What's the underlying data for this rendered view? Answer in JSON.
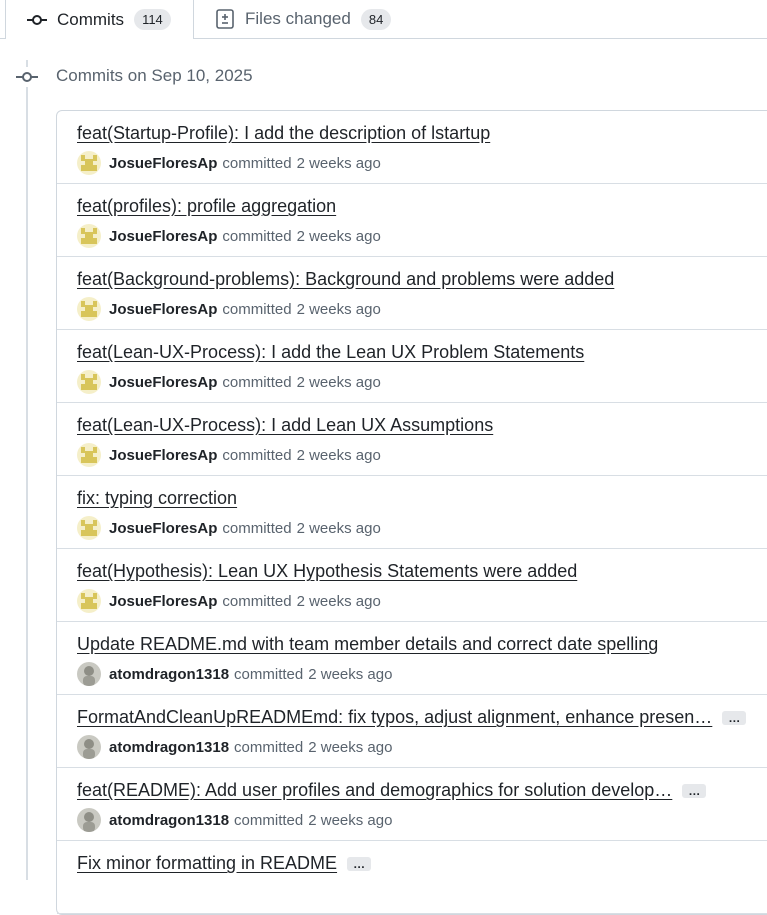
{
  "tabs": {
    "commits": {
      "label": "Commits",
      "count": "114"
    },
    "files": {
      "label": "Files changed",
      "count": "84"
    }
  },
  "group": {
    "heading": "Commits on Sep 10, 2025"
  },
  "commits": [
    {
      "title": "feat(Startup-Profile): I add the description of lstartup",
      "author": "JosueFloresAp",
      "action": "committed",
      "time": "2 weeks ago",
      "has_more": false,
      "avatar": "yellow-identicon"
    },
    {
      "title": "feat(profiles): profile aggregation",
      "author": "JosueFloresAp",
      "action": "committed",
      "time": "2 weeks ago",
      "has_more": false,
      "avatar": "yellow-identicon"
    },
    {
      "title": "feat(Background-problems): Background and problems were added",
      "author": "JosueFloresAp",
      "action": "committed",
      "time": "2 weeks ago",
      "has_more": false,
      "avatar": "yellow-identicon"
    },
    {
      "title": "feat(Lean-UX-Process): I add the Lean UX Problem Statements",
      "author": "JosueFloresAp",
      "action": "committed",
      "time": "2 weeks ago",
      "has_more": false,
      "avatar": "yellow-identicon"
    },
    {
      "title": "feat(Lean-UX-Process): I add Lean UX Assumptions",
      "author": "JosueFloresAp",
      "action": "committed",
      "time": "2 weeks ago",
      "has_more": false,
      "avatar": "yellow-identicon"
    },
    {
      "title": "fix: typing correction",
      "author": "JosueFloresAp",
      "action": "committed",
      "time": "2 weeks ago",
      "has_more": false,
      "avatar": "yellow-identicon"
    },
    {
      "title": "feat(Hypothesis): Lean UX Hypothesis Statements were added",
      "author": "JosueFloresAp",
      "action": "committed",
      "time": "2 weeks ago",
      "has_more": false,
      "avatar": "yellow-identicon"
    },
    {
      "title": "Update README.md with team member details and correct date spelling",
      "author": "atomdragon1318",
      "action": "committed",
      "time": "2 weeks ago",
      "has_more": false,
      "avatar": "gray-photo"
    },
    {
      "title": "FormatAndCleanUpREADMEmd: fix typos, adjust alignment, enhance presen…",
      "author": "atomdragon1318",
      "action": "committed",
      "time": "2 weeks ago",
      "has_more": true,
      "avatar": "gray-photo"
    },
    {
      "title": "feat(README): Add user profiles and demographics for solution develop…",
      "author": "atomdragon1318",
      "action": "committed",
      "time": "2 weeks ago",
      "has_more": true,
      "avatar": "gray-photo"
    },
    {
      "title": "Fix minor formatting in README",
      "author": "",
      "action": "",
      "time": "",
      "has_more": true,
      "avatar": "gray-photo"
    }
  ],
  "ellipsis_label": "…",
  "icons": {
    "commit": "git-commit-icon",
    "files": "file-diff-icon"
  },
  "colors": {
    "accent_yellow": "#e3d27a",
    "muted_text": "#59636e",
    "border": "#d0d7de"
  }
}
